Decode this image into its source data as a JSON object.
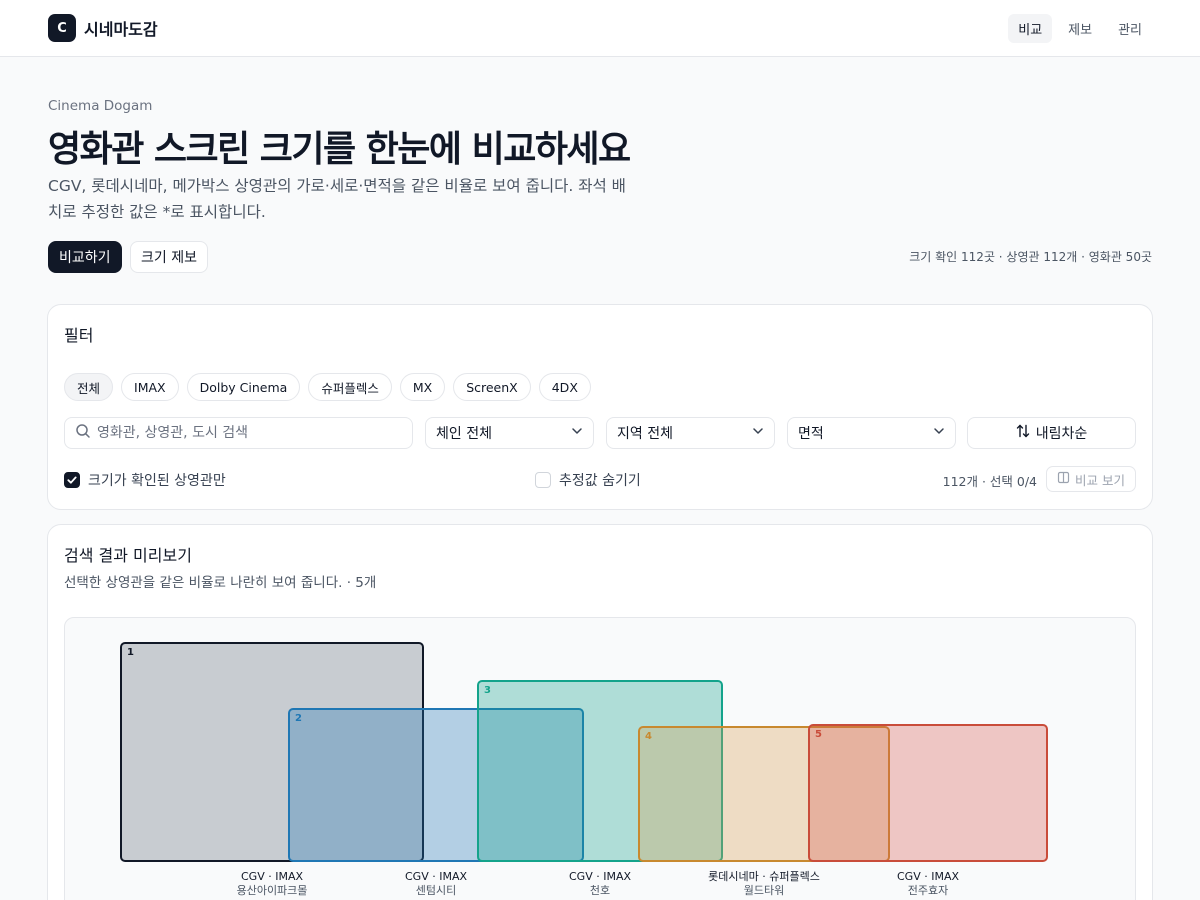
{
  "app": {
    "logo_letter": "C",
    "name": "시네마도감"
  },
  "nav": [
    "비교",
    "제보",
    "관리"
  ],
  "hero": {
    "eyebrow": "Cinema Dogam",
    "title": "영화관 스크린 크기를 한눈에 비교하세요",
    "description": "CGV, 롯데시네마, 메가박스 상영관의 가로·세로·면적을 같은 비율로 보여 줍니다. 좌석 배치로 추정한 값은 *로 표시합니다.",
    "primary_button": "비교하기",
    "secondary_button": "크기 제보",
    "stats": "크기 확인 112곳 · 상영관 112개 · 영화관 50곳"
  },
  "filter": {
    "title": "필터",
    "chips": [
      "전체",
      "IMAX",
      "Dolby Cinema",
      "슈퍼플렉스",
      "MX",
      "ScreenX",
      "4DX"
    ],
    "active_chip": "전체",
    "search_placeholder": "영화관, 상영관, 도시 검색",
    "chain_select": "체인 전체",
    "region_select": "지역 전체",
    "sort_field": "면적",
    "sort_order": "내림차순",
    "verified_only_label": "크기가 확인된 상영관만",
    "verified_only_checked": true,
    "hide_estimates_label": "추정값 숨기기",
    "hide_estimates_checked": false,
    "count_info": "112개 · 선택 0/4",
    "view_button": "비교 보기"
  },
  "preview": {
    "title": "검색 결과 미리보기",
    "subtitle": "선택한 상영관을 같은 비율로 나란히 보여 줍니다. · 5개",
    "screens": [
      {
        "rank": "1",
        "chain_format": "CGV · IMAX",
        "theater": "용산아이파크몰",
        "color": "#111827",
        "fill": "rgba(75,85,99,0.28)"
      },
      {
        "rank": "2",
        "chain_format": "CGV · IMAX",
        "theater": "센텀시티",
        "color": "#1f77b4",
        "fill": "rgba(31,119,180,0.32)"
      },
      {
        "rank": "3",
        "chain_format": "CGV · IMAX",
        "theater": "천호",
        "color": "#14a38b",
        "fill": "rgba(20,163,139,0.32)"
      },
      {
        "rank": "4",
        "chain_format": "롯데시네마 · 슈퍼플렉스",
        "theater": "월드타워",
        "color": "#c8892f",
        "fill": "rgba(214,160,80,0.32)"
      },
      {
        "rank": "5",
        "chain_format": "CGV · IMAX",
        "theater": "전주효자",
        "color": "#c94c3a",
        "fill": "rgba(215,90,80,0.32)"
      }
    ]
  }
}
